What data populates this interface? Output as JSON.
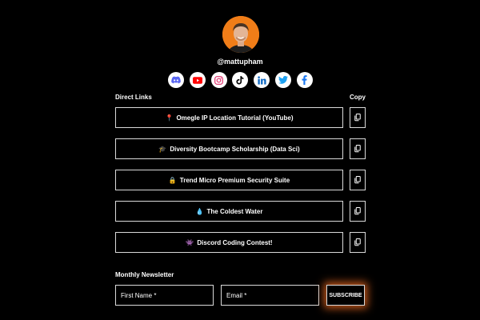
{
  "profile": {
    "handle": "@mattupham",
    "avatar_alt": "profile photo"
  },
  "socials": [
    {
      "icon": "discord-icon",
      "color": "#5865F2"
    },
    {
      "icon": "youtube-icon",
      "color": "#FF0000"
    },
    {
      "icon": "instagram-icon",
      "color": "#E1306C"
    },
    {
      "icon": "tiktok-icon",
      "color": "#000000"
    },
    {
      "icon": "linkedin-icon",
      "color": "#0A66C2"
    },
    {
      "icon": "twitter-icon",
      "color": "#1DA1F2"
    },
    {
      "icon": "facebook-icon",
      "color": "#1877F2"
    }
  ],
  "links_section": {
    "title": "Direct Links",
    "copy_header": "Copy",
    "items": [
      {
        "emoji": "📍",
        "label": "Omegle IP Location Tutorial (YouTube)"
      },
      {
        "emoji": "🎓",
        "label": "Diversity Bootcamp Scholarship (Data Sci)"
      },
      {
        "emoji": "🔒",
        "label": "Trend Micro Premium Security Suite"
      },
      {
        "emoji": "💧",
        "label": "The Coldest Water"
      },
      {
        "emoji": "👾",
        "label": "Discord Coding Contest!"
      }
    ]
  },
  "newsletter": {
    "title": "Monthly Newsletter",
    "first_name_placeholder": "First Name *",
    "email_placeholder": "Email *",
    "subscribe_label": "SUBSCRIBE"
  },
  "colors": {
    "background": "#000000",
    "border": "#d9d9d9",
    "accent_glow": "#eb691e"
  }
}
